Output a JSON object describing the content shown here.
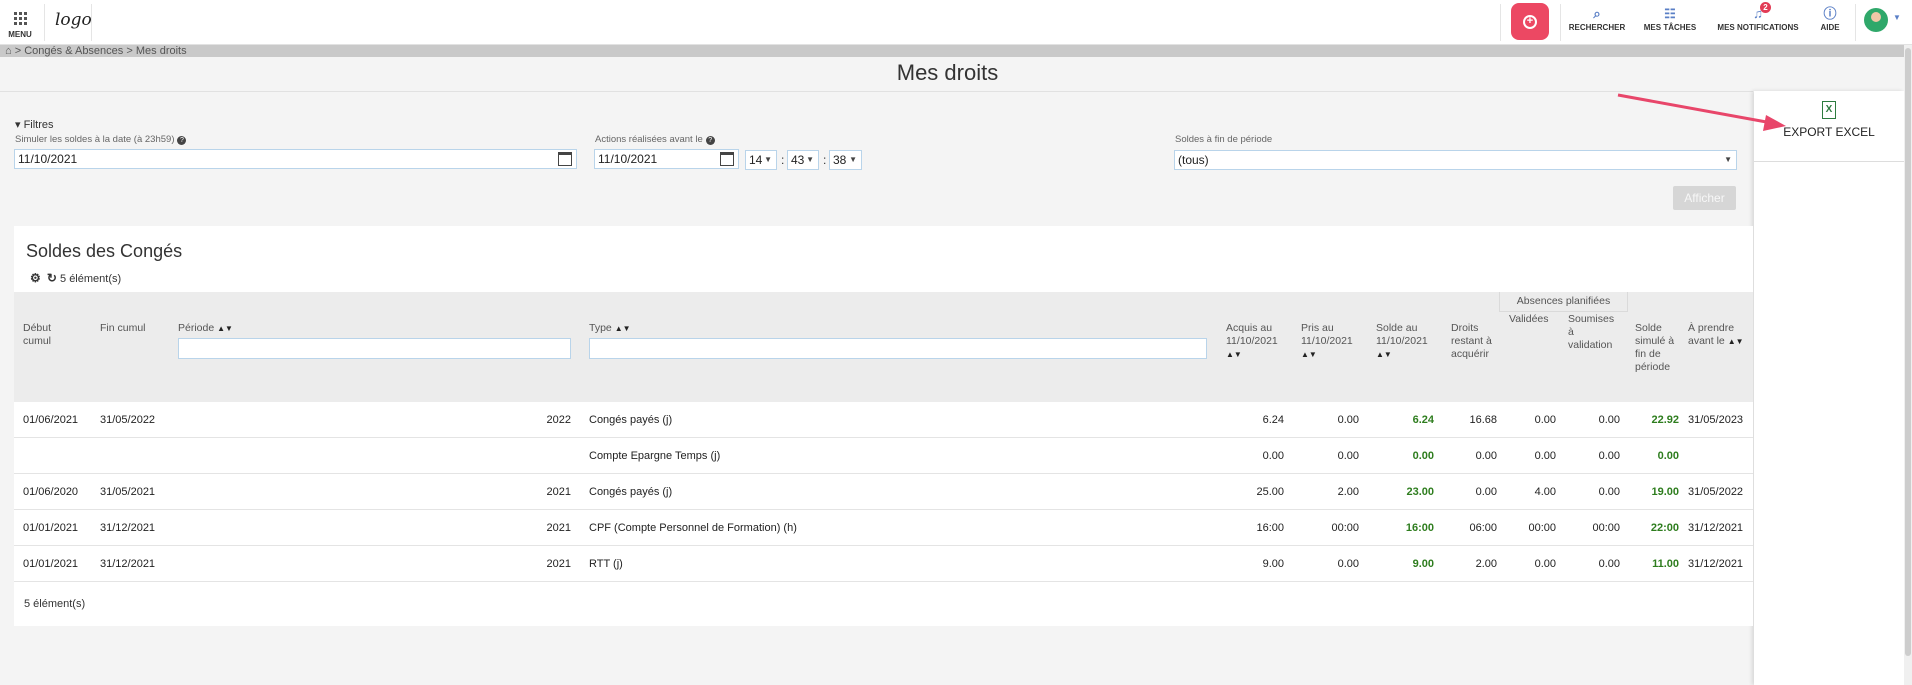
{
  "topbar": {
    "menu_label": "MENU",
    "logo_text": "logo",
    "nav": [
      {
        "label": "RECHERCHER",
        "icon": "search-icon"
      },
      {
        "label": "MES TÂCHES",
        "icon": "tasks-icon"
      },
      {
        "label": "MES NOTIFICATIONS",
        "icon": "bell-icon",
        "badge": "2"
      },
      {
        "label": "AIDE",
        "icon": "help-icon"
      }
    ],
    "accent": "#ec4863"
  },
  "breadcrumb": {
    "home": "⌂",
    "sep1": ">",
    "section": "Congés & Absences",
    "sep2": ">",
    "page": "Mes droits"
  },
  "page_title": "Mes droits",
  "side_panel": {
    "export_label": "EXPORT EXCEL",
    "icon": "excel-icon"
  },
  "filters": {
    "toggle_label": "Filtres",
    "simulate_label": "Simuler les soldes à la date (à 23h59)",
    "simulate_value": "11/10/2021",
    "actions_label": "Actions réalisées avant le",
    "actions_date": "11/10/2021",
    "hour": "14",
    "minute": "43",
    "second": "38",
    "soldes_label": "Soldes à fin de période",
    "soldes_value": "(tous)",
    "submit_label": "Afficher"
  },
  "table": {
    "title": "Soldes des Congés",
    "count_label": "5 élément(s)",
    "group_header": "Absences planifiées",
    "columns": [
      "Début cumul",
      "Fin cumul",
      "Période",
      "Type",
      "Acquis au 11/10/2021",
      "Pris au 11/10/2021",
      "Solde au 11/10/2021",
      "Droits restant à acquérir",
      "Validées",
      "Soumises à validation",
      "Solde simulé à fin de période",
      "À prendre avant le"
    ],
    "rows": [
      [
        "01/06/2021",
        "31/05/2022",
        "2022",
        "Congés payés (j)",
        "6.24",
        "0.00",
        "6.24",
        "16.68",
        "0.00",
        "0.00",
        "22.92",
        "31/05/2023"
      ],
      [
        "",
        "",
        "",
        "Compte Epargne Temps (j)",
        "0.00",
        "0.00",
        "0.00",
        "0.00",
        "0.00",
        "0.00",
        "0.00",
        ""
      ],
      [
        "01/06/2020",
        "31/05/2021",
        "2021",
        "Congés payés (j)",
        "25.00",
        "2.00",
        "23.00",
        "0.00",
        "4.00",
        "0.00",
        "19.00",
        "31/05/2022"
      ],
      [
        "01/01/2021",
        "31/12/2021",
        "2021",
        "CPF (Compte Personnel de Formation) (h)",
        "16:00",
        "00:00",
        "16:00",
        "06:00",
        "00:00",
        "00:00",
        "22:00",
        "31/12/2021"
      ],
      [
        "01/01/2021",
        "31/12/2021",
        "2021",
        "RTT (j)",
        "9.00",
        "0.00",
        "9.00",
        "2.00",
        "0.00",
        "0.00",
        "11.00",
        "31/12/2021"
      ]
    ],
    "footer": "5 élément(s)"
  }
}
